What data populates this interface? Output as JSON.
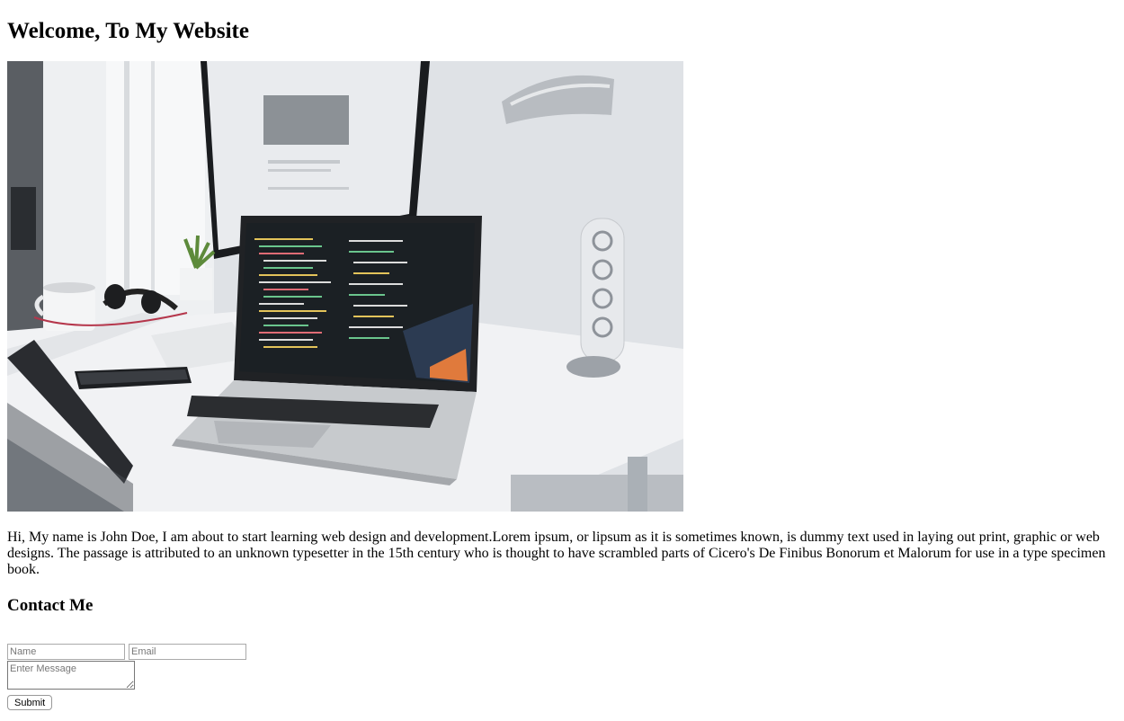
{
  "header": {
    "title": "Welcome, To My Website"
  },
  "hero": {
    "image_description": "desk-laptop-photo"
  },
  "intro": {
    "text": "Hi, My name is John Doe, I am about to start learning web design and development.Lorem ipsum, or lipsum as it is sometimes known, is dummy text used in laying out print, graphic or web designs. The passage is attributed to an unknown typesetter in the 15th century who is thought to have scrambled parts of Cicero's De Finibus Bonorum et Malorum for use in a type specimen book."
  },
  "contact": {
    "heading": "Contact Me",
    "name_placeholder": "Name",
    "email_placeholder": "Email",
    "message_placeholder": "Enter Message",
    "submit_label": "Submit"
  }
}
